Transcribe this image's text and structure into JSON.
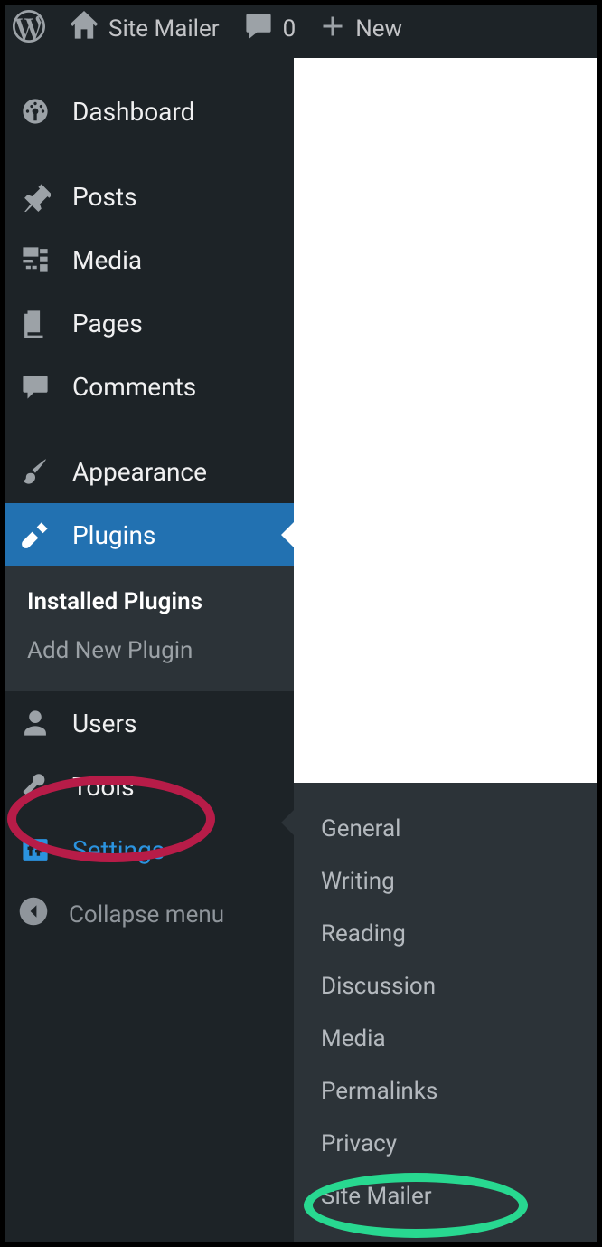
{
  "toolbar": {
    "site_name": "Site Mailer",
    "comments_count": "0",
    "new_label": "New"
  },
  "sidebar": {
    "dashboard": "Dashboard",
    "posts": "Posts",
    "media": "Media",
    "pages": "Pages",
    "comments": "Comments",
    "appearance": "Appearance",
    "plugins": "Plugins",
    "plugins_sub": {
      "installed": "Installed Plugins",
      "add_new": "Add New Plugin"
    },
    "users": "Users",
    "tools": "Tools",
    "settings": "Settings",
    "collapse": "Collapse menu"
  },
  "settings_flyout": {
    "general": "General",
    "writing": "Writing",
    "reading": "Reading",
    "discussion": "Discussion",
    "media": "Media",
    "permalinks": "Permalinks",
    "privacy": "Privacy",
    "site_mailer": "Site Mailer"
  }
}
